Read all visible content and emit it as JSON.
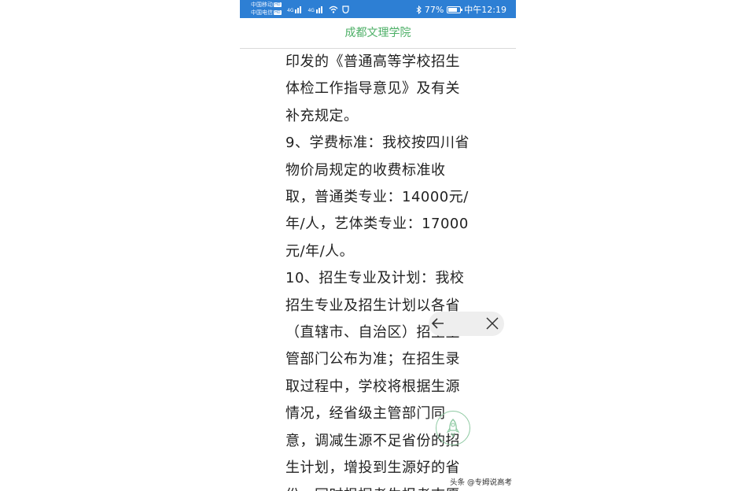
{
  "status_bar": {
    "carrier_1": "中国移动",
    "carrier_2": "中国电信",
    "hd": "HD",
    "net_1": "4G",
    "net_2": "4G",
    "battery_text": "77%",
    "battery_level": 0.77,
    "time": "中午12:19"
  },
  "header": {
    "title": "成都文理学院"
  },
  "content": {
    "lines": [
      "印发的《普通高等学校招生",
      "体检工作指导意见》及有关",
      "补充规定。",
      "9、学费标准：我校按四川省",
      "物价局规定的收费标准收",
      "取，普通类专业：14000元/",
      "年/人，艺体类专业：17000",
      "元/年/人。",
      "10、招生专业及计划：我校",
      "招生专业及招生计划以各省",
      "（直辖市、自治区）招生主",
      "管部门公布为准；在招生录",
      "取过程中，学校将根据生源",
      "情况，经省级主管部门同",
      "意，调减生源不足省份的招",
      "生计划，增投到生源好的省",
      "份，同时根据考生报考志愿"
    ]
  },
  "overlay": {
    "back_icon": "arrow-left-icon",
    "close_icon": "close-icon",
    "rocket_icon": "rocket-icon"
  },
  "watermark": "头条 @专姆说高考",
  "colors": {
    "status_bar": "#2d7fd4",
    "title": "#4caf66"
  }
}
